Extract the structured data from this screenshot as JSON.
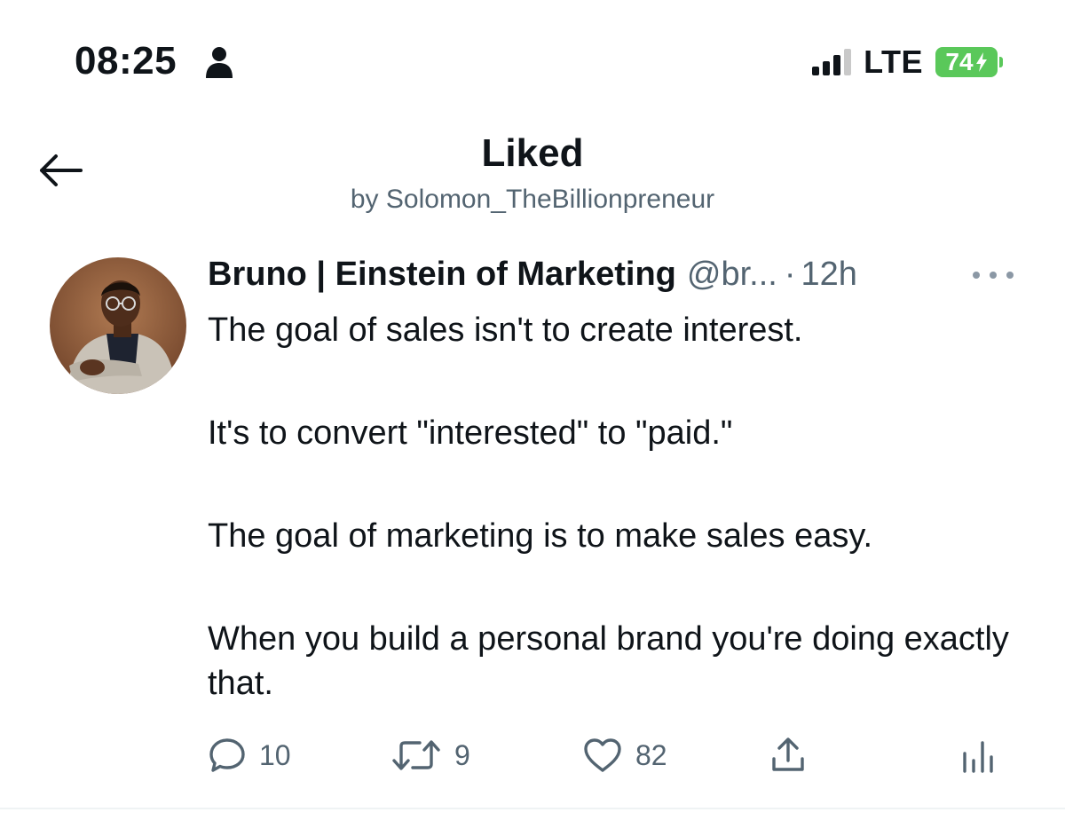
{
  "status_bar": {
    "time": "08:25",
    "network": "LTE",
    "battery": "74",
    "battery_charging": true,
    "person_icon": "person-icon",
    "signal_icon": "signal-bars-icon",
    "charging_icon": "bolt-icon"
  },
  "header": {
    "title": "Liked",
    "subtitle": "by Solomon_TheBillionpreneur",
    "back_icon": "arrow-left-icon"
  },
  "tweet": {
    "author_name": "Bruno | Einstein of Marketing",
    "author_handle": "@br...",
    "separator": "·",
    "time": "12h",
    "more_icon": "more-horizontal-icon",
    "paragraphs": [
      "The goal of sales isn't to create interest.",
      "It's to convert \"interested\" to \"paid.\"",
      "The goal of marketing is to make sales easy.",
      "When you build a personal brand you're doing exactly that."
    ],
    "actions": {
      "reply": {
        "icon": "reply-icon",
        "count": "10"
      },
      "retweet": {
        "icon": "retweet-icon",
        "count": "9"
      },
      "like": {
        "icon": "heart-icon",
        "count": "82"
      },
      "share": {
        "icon": "share-icon"
      },
      "analytics": {
        "icon": "analytics-icon"
      }
    }
  },
  "colors": {
    "text_primary": "#0f1419",
    "text_secondary": "#536471",
    "battery_green": "#5ac85a",
    "divider": "#eff3f4"
  }
}
